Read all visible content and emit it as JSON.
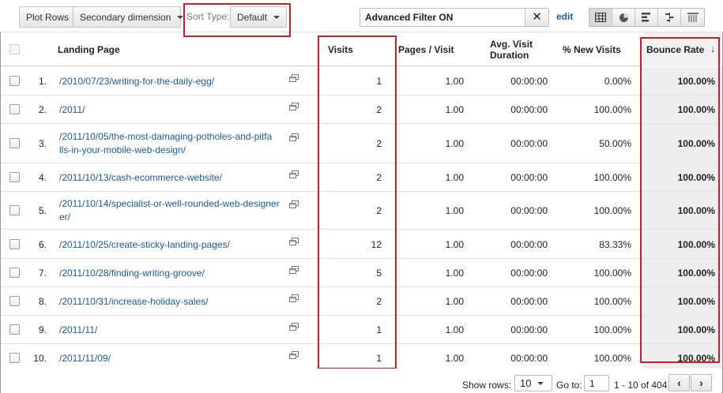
{
  "toolbar": {
    "plot_rows_label": "Plot Rows",
    "secondary_dimension_label": "Secondary dimension",
    "sort_type_label": "Sort Type:",
    "sort_type_value": "Default",
    "filter_text": "Advanced Filter ON",
    "filter_clear": "✕",
    "edit_label": "edit",
    "view_icons": [
      "table-view-icon",
      "pie-view-icon",
      "bar-view-icon",
      "comparison-view-icon",
      "pivot-view-icon"
    ]
  },
  "table": {
    "headers": {
      "landing_page": "Landing Page",
      "visits": "Visits",
      "pages_visit": "Pages / Visit",
      "avg_visit_duration_1": "Avg. Visit",
      "avg_visit_duration_2": "Duration",
      "new_visits": "% New Visits",
      "bounce_rate": "Bounce Rate",
      "sort_arrow": "↓"
    },
    "rows": [
      {
        "index": "1.",
        "page_line1": "/2010/07/23/writing-for-the-daily-egg/",
        "page_line2": "",
        "visits": "1",
        "pages_visit": "1.00",
        "duration": "00:00:00",
        "new_visits": "0.00%",
        "bounce": "100.00%"
      },
      {
        "index": "2.",
        "page_line1": "/2011/",
        "page_line2": "",
        "visits": "2",
        "pages_visit": "1.00",
        "duration": "00:00:00",
        "new_visits": "100.00%",
        "bounce": "100.00%"
      },
      {
        "index": "3.",
        "page_line1": "/2011/10/05/the-most-damaging-potholes-and-pitfa",
        "page_line2": "lls-in-your-mobile-web-design/",
        "visits": "2",
        "pages_visit": "1.00",
        "duration": "00:00:00",
        "new_visits": "50.00%",
        "bounce": "100.00%"
      },
      {
        "index": "4.",
        "page_line1": "/2011/10/13/cash-ecommerce-website/",
        "page_line2": "",
        "visits": "2",
        "pages_visit": "1.00",
        "duration": "00:00:00",
        "new_visits": "100.00%",
        "bounce": "100.00%"
      },
      {
        "index": "5.",
        "page_line1": "/2011/10/14/specialist-or-well-rounded-web-designer",
        "page_line2": "er/",
        "visits": "2",
        "pages_visit": "1.00",
        "duration": "00:00:00",
        "new_visits": "100.00%",
        "bounce": "100.00%"
      },
      {
        "index": "6.",
        "page_line1": "/2011/10/25/create-sticky-landing-pages/",
        "page_line2": "",
        "visits": "12",
        "pages_visit": "1.00",
        "duration": "00:00:00",
        "new_visits": "83.33%",
        "bounce": "100.00%"
      },
      {
        "index": "7.",
        "page_line1": "/2011/10/28/finding-writing-groove/",
        "page_line2": "",
        "visits": "5",
        "pages_visit": "1.00",
        "duration": "00:00:00",
        "new_visits": "100.00%",
        "bounce": "100.00%"
      },
      {
        "index": "8.",
        "page_line1": "/2011/10/31/increase-holiday-sales/",
        "page_line2": "",
        "visits": "2",
        "pages_visit": "1.00",
        "duration": "00:00:00",
        "new_visits": "100.00%",
        "bounce": "100.00%"
      },
      {
        "index": "9.",
        "page_line1": "/2011/11/",
        "page_line2": "",
        "visits": "1",
        "pages_visit": "1.00",
        "duration": "00:00:00",
        "new_visits": "100.00%",
        "bounce": "100.00%"
      },
      {
        "index": "10.",
        "page_line1": "/2011/11/09/",
        "page_line2": "",
        "visits": "1",
        "pages_visit": "1.00",
        "duration": "00:00:00",
        "new_visits": "100.00%",
        "bounce": "100.00%"
      }
    ]
  },
  "footer": {
    "show_rows_label": "Show rows:",
    "show_rows_value": "10",
    "goto_label": "Go to:",
    "goto_value": "1",
    "range_text": "1 - 10 of 404",
    "prev": "‹",
    "next": "›"
  },
  "colors": {
    "link": "#1a5aa6",
    "highlight": "#c8202a"
  }
}
